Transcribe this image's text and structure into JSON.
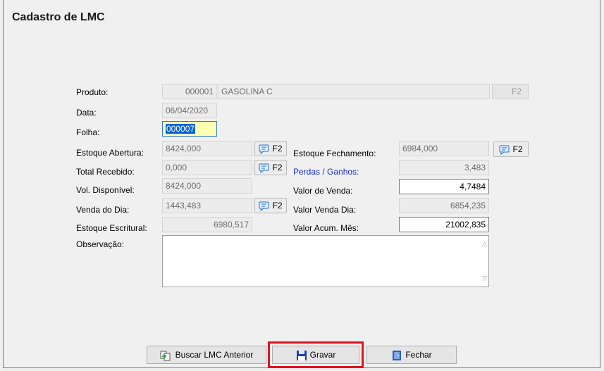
{
  "window": {
    "title": "Cadastro de LMC"
  },
  "labels": {
    "produto": "Produto:",
    "data": "Data:",
    "folha": "Folha:",
    "estoque_abertura": "Estoque Abertura:",
    "total_recebido": "Total Recebido:",
    "vol_disponivel": "Vol. Disponível:",
    "venda_do_dia": "Venda do Dia:",
    "estoque_escritural": "Estoque Escritural:",
    "observacao": "Observação:",
    "estoque_fechamento": "Estoque Fechamento:",
    "perdas_ganhos": "Perdas / Ganhos:",
    "valor_de_venda": "Valor de Venda:",
    "valor_venda_dia": "Valor Venda Dia:",
    "valor_acum_mes": "Valor Acum. Mês:"
  },
  "fields": {
    "produto_codigo": "000001",
    "produto_nome": "GASOLINA C",
    "data": "06/04/2020",
    "folha": "000007",
    "estoque_abertura": "8424,000",
    "total_recebido": "0,000",
    "vol_disponivel": "8424,000",
    "venda_do_dia": "1443,483",
    "estoque_escritural": "6980,517",
    "estoque_fechamento": "6984,000",
    "perdas_ganhos": "3,483",
    "valor_de_venda": "4,7484",
    "valor_venda_dia": "6854,235",
    "valor_acum_mes": "21002,835",
    "observacao": ""
  },
  "f2_label": "F2",
  "buttons": {
    "buscar": "Buscar LMC Anterior",
    "gravar": "Gravar",
    "fechar": "Fechar"
  },
  "colors": {
    "accent_blue": "#1a2fd6",
    "highlight_red": "#e0121b",
    "focus_fill": "#ffffb3"
  }
}
